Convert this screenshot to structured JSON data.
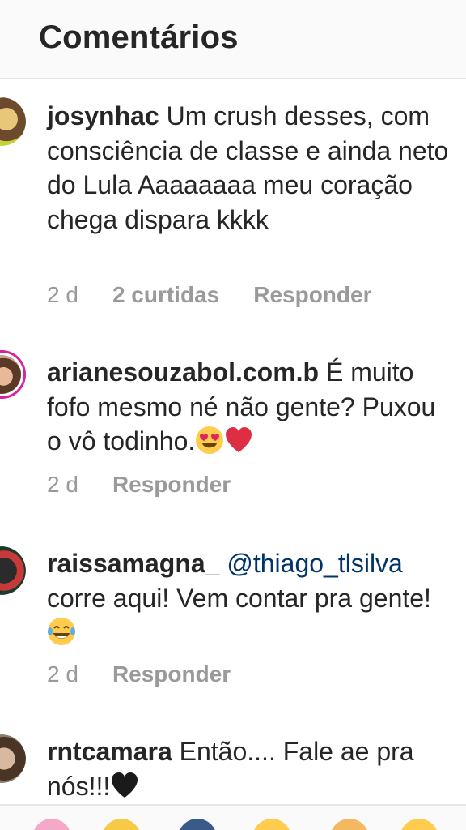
{
  "header": {
    "title": "Comentários"
  },
  "comments": [
    {
      "username": "josynhac",
      "text": "Um crush desses, com consciência de classe e ainda neto do Lula Aaaaaaaa meu coração chega dispara kkkk",
      "time": "2 d",
      "likes": "2 curtidas",
      "reply": "Responder"
    },
    {
      "username": "arianesouzabol.com.b",
      "text": "É muito fofo mesmo né não gente? Puxou o vô todinho.",
      "emojis": [
        "heart-eyes-emoji",
        "red-heart-emoji"
      ],
      "time": "2 d",
      "reply": "Responder"
    },
    {
      "username": "raissamagna_",
      "mention": "@thiago_tlsilva",
      "text": "corre aqui! Vem contar pra gente!",
      "emojis": [
        "tears-of-joy-emoji"
      ],
      "time": "2 d",
      "reply": "Responder"
    },
    {
      "username": "rntcamara",
      "text": "Então.... Fale ae pra nós!!!",
      "emojis": [
        "black-heart-emoji"
      ]
    }
  ],
  "reaction_bar": {
    "icons": [
      "heart-reaction-icon",
      "clap-reaction-icon",
      "fire-reaction-icon",
      "smile-reaction-icon",
      "hands-reaction-icon",
      "laugh-reaction-icon"
    ]
  },
  "colors": {
    "text": "#262626",
    "meta": "#999999",
    "mention": "#003569",
    "story_ring": "#d6249f",
    "header_bg": "#fafafa"
  }
}
